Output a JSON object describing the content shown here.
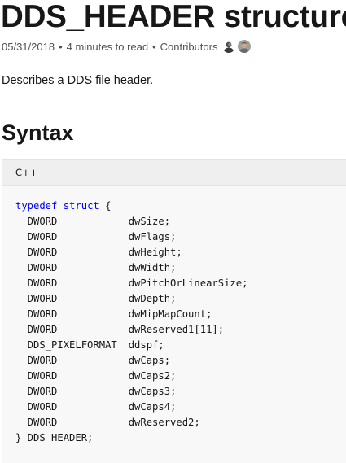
{
  "article": {
    "title": "DDS_HEADER structure",
    "date": "05/31/2018",
    "read_time": "4 minutes to read",
    "contributors_label": "Contributors",
    "meta_separator": "•",
    "description": "Describes a DDS file header.",
    "syntax_heading": "Syntax"
  },
  "code_block": {
    "language": "C++",
    "opening_keyword_1": "typedef",
    "opening_keyword_2": "struct",
    "opening_brace": "{",
    "members": [
      {
        "type": "DWORD",
        "name": "dwSize;"
      },
      {
        "type": "DWORD",
        "name": "dwFlags;"
      },
      {
        "type": "DWORD",
        "name": "dwHeight;"
      },
      {
        "type": "DWORD",
        "name": "dwWidth;"
      },
      {
        "type": "DWORD",
        "name": "dwPitchOrLinearSize;"
      },
      {
        "type": "DWORD",
        "name": "dwDepth;"
      },
      {
        "type": "DWORD",
        "name": "dwMipMapCount;"
      },
      {
        "type": "DWORD",
        "name": "dwReserved1[11];"
      },
      {
        "type": "DDS_PIXELFORMAT",
        "name": "ddspf;"
      },
      {
        "type": "DWORD",
        "name": "dwCaps;"
      },
      {
        "type": "DWORD",
        "name": "dwCaps2;"
      },
      {
        "type": "DWORD",
        "name": "dwCaps3;"
      },
      {
        "type": "DWORD",
        "name": "dwCaps4;"
      },
      {
        "type": "DWORD",
        "name": "dwReserved2;"
      }
    ],
    "closing_line": "} DDS_HEADER;"
  },
  "colors": {
    "keyword": "#0101fd",
    "text": "#171717",
    "meta_text": "#505050",
    "code_background": "#f8f8f8",
    "code_header_background": "#efefef"
  },
  "icons": {
    "contributor_avatar_1": "avatar-icon",
    "contributor_avatar_2": "avatar-icon"
  }
}
